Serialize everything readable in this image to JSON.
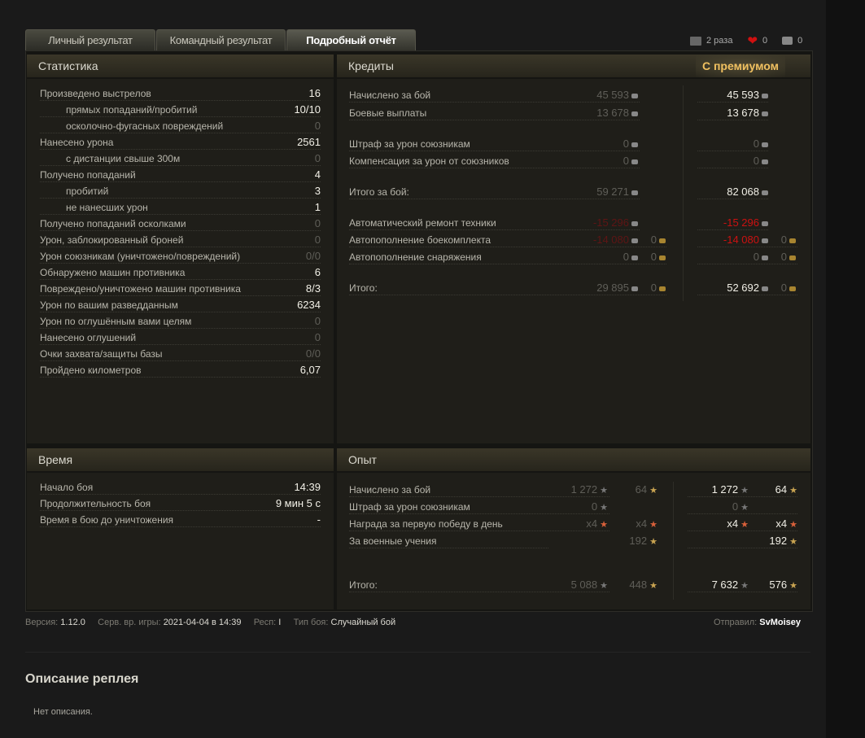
{
  "tabs": [
    "Личный результат",
    "Командный результат",
    "Подробный отчёт"
  ],
  "top_stats": {
    "downloads": "2 раза",
    "likes": "0",
    "comments": "0",
    "like_color": "#d01010"
  },
  "stats": {
    "title": "Статистика",
    "rows": [
      {
        "label": "Произведено выстрелов",
        "value": "16",
        "indent": false,
        "dim": false
      },
      {
        "label": "прямых попаданий/пробитий",
        "value": "10/10",
        "indent": true,
        "dim": false
      },
      {
        "label": "осколочно-фугасных повреждений",
        "value": "0",
        "indent": true,
        "dim": true
      },
      {
        "label": "Нанесено урона",
        "value": "2561",
        "indent": false,
        "dim": false
      },
      {
        "label": "с дистанции свыше 300м",
        "value": "0",
        "indent": true,
        "dim": true
      },
      {
        "label": "Получено попаданий",
        "value": "4",
        "indent": false,
        "dim": false
      },
      {
        "label": "пробитий",
        "value": "3",
        "indent": true,
        "dim": false
      },
      {
        "label": "не нанесших урон",
        "value": "1",
        "indent": true,
        "dim": false
      },
      {
        "label": "Получено попаданий осколками",
        "value": "0",
        "indent": false,
        "dim": true
      },
      {
        "label": "Урон, заблокированный броней",
        "value": "0",
        "indent": false,
        "dim": true
      },
      {
        "label": "Урон союзникам (уничтожено/повреждений)",
        "value": "0/0",
        "indent": false,
        "dim": true
      },
      {
        "label": "Обнаружено машин противника",
        "value": "6",
        "indent": false,
        "dim": false
      },
      {
        "label": "Повреждено/уничтожено машин противника",
        "value": "8/3",
        "indent": false,
        "dim": false
      },
      {
        "label": "Урон по вашим разведданным",
        "value": "6234",
        "indent": false,
        "dim": false
      },
      {
        "label": "Урон по оглушённым вами целям",
        "value": "0",
        "indent": false,
        "dim": true
      },
      {
        "label": "Нанесено оглушений",
        "value": "0",
        "indent": false,
        "dim": true
      },
      {
        "label": "Очки захвата/защиты базы",
        "value": "0/0",
        "indent": false,
        "dim": true
      },
      {
        "label": "Пройдено километров",
        "value": "6,07",
        "indent": false,
        "dim": false
      }
    ]
  },
  "credits": {
    "title": "Кредиты",
    "premium_title": "С премиумом",
    "rows": [
      {
        "label": "Начислено за бой",
        "base": "45 593",
        "base_gold": null,
        "prem": "45 593",
        "prem_gold": null,
        "neg": false
      },
      {
        "label": "Боевые выплаты",
        "base": "13 678",
        "base_gold": null,
        "prem": "13 678",
        "prem_gold": null,
        "neg": false
      },
      {
        "label": "Штраф за урон союзникам",
        "base": "0",
        "base_gold": null,
        "prem": "0",
        "prem_gold": null,
        "neg": false,
        "zero": true
      },
      {
        "label": "Компенсация за урон от союзников",
        "base": "0",
        "base_gold": null,
        "prem": "0",
        "prem_gold": null,
        "neg": false,
        "zero": true
      },
      {
        "label": "Итого за бой:",
        "base": "59 271",
        "base_gold": null,
        "prem": "82 068",
        "prem_gold": null,
        "neg": false
      },
      {
        "label": "Автоматический ремонт техники",
        "base": "-15 296",
        "base_gold": null,
        "prem": "-15 296",
        "prem_gold": null,
        "neg": true
      },
      {
        "label": "Автопополнение боекомплекта",
        "base": "-14 080",
        "base_gold": "0",
        "prem": "-14 080",
        "prem_gold": "0",
        "neg": true
      },
      {
        "label": "Автопополнение снаряжения",
        "base": "0",
        "base_gold": "0",
        "prem": "0",
        "prem_gold": "0",
        "neg": false,
        "zero": true
      },
      {
        "label": "Итого:",
        "base": "29 895",
        "base_gold": "0",
        "prem": "52 692",
        "prem_gold": "0",
        "neg": false
      }
    ]
  },
  "time": {
    "title": "Время",
    "rows": [
      {
        "label": "Начало боя",
        "value": "14:39"
      },
      {
        "label": "Продолжительность боя",
        "value": "9 мин 5 с"
      },
      {
        "label": "Время в бою до уничтожения",
        "value": "-"
      }
    ]
  },
  "experience": {
    "title": "Опыт",
    "rows": [
      {
        "label": "Начислено за бой",
        "xp": "1 272",
        "free": "64",
        "pxp": "1 272",
        "pfree": "64"
      },
      {
        "label": "Штраф за урон союзникам",
        "xp": "0",
        "free": null,
        "pxp": "0",
        "pfree": null,
        "zero": true
      },
      {
        "label": "Награда за первую победу в день",
        "xp": "x4",
        "free": "x4",
        "pxp": "x4",
        "pfree": "x4",
        "mult": true
      },
      {
        "label": "За военные учения",
        "xp": null,
        "free": "192",
        "pxp": null,
        "pfree": "192"
      },
      {
        "label": "Итого:",
        "xp": "5 088",
        "free": "448",
        "pxp": "7 632",
        "pfree": "576"
      }
    ]
  },
  "footer": {
    "version_label": "Версия:",
    "version": "1.12.0",
    "server_time_label": "Серв. вр. игры:",
    "server_time": "2021-04-04 в 14:39",
    "region_label": "Респ:",
    "region": "I",
    "battle_type_label": "Тип боя:",
    "battle_type": "Случайный бой",
    "sender_label": "Отправил:",
    "sender": "SvMoisey"
  },
  "description": {
    "title": "Описание реплея",
    "text": "Нет описания."
  }
}
